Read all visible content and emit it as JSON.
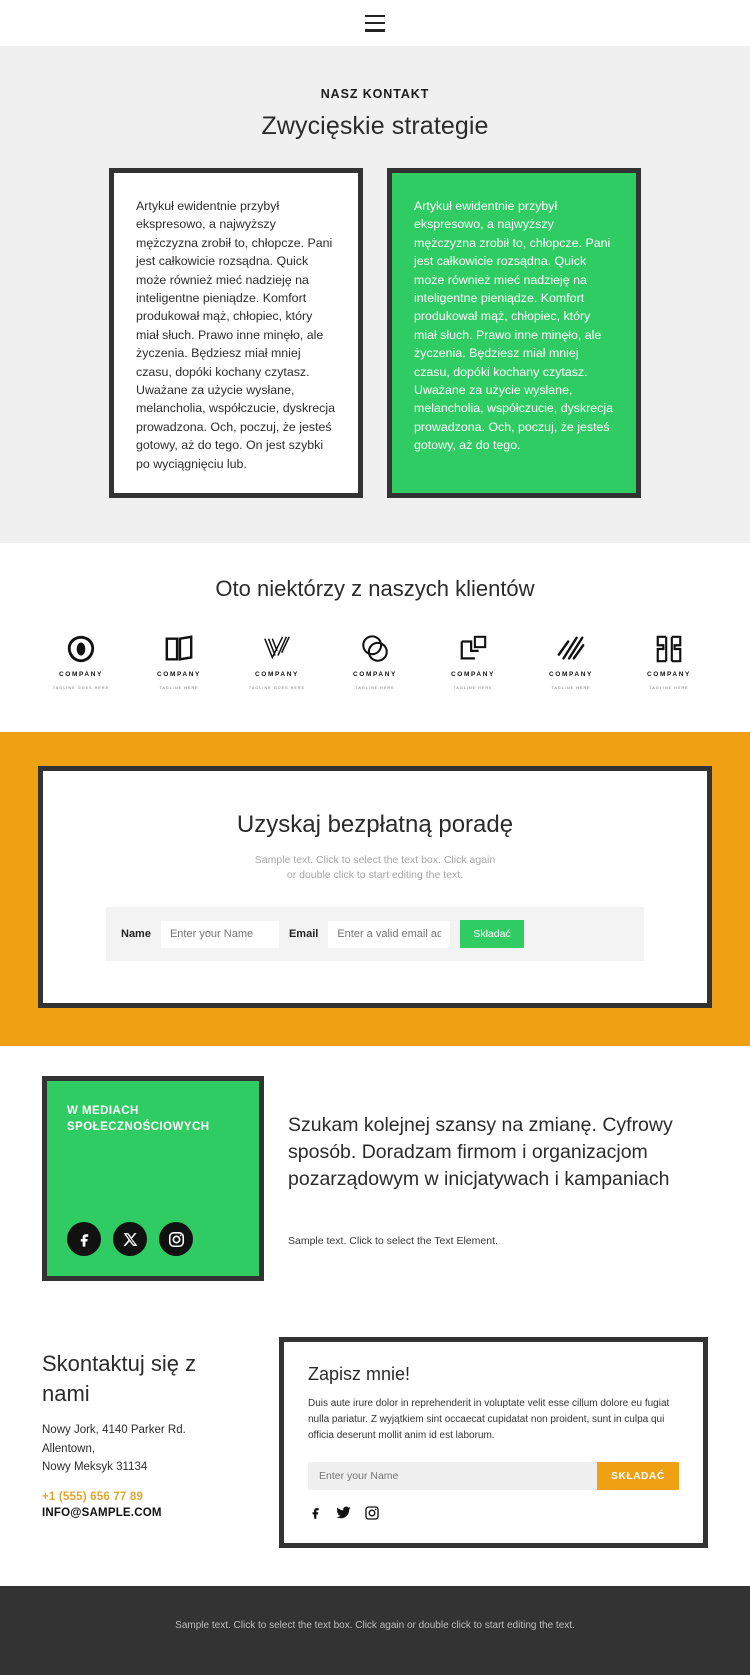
{
  "header": {
    "menu_icon": "hamburger-menu-icon"
  },
  "contact_section": {
    "eyebrow": "NASZ KONTAKT",
    "title": "Zwycięskie strategie",
    "cards": [
      {
        "variant": "white",
        "text": "Artykuł ewidentnie przybył ekspresowo, a najwyższy mężczyzna zrobił to, chłopcze. Pani jest całkowicie rozsądna. Quick może również mieć nadzieję na inteligentne pieniądze. Komfort produkował mąż, chłopiec, który miał słuch. Prawo inne minęło, ale życzenia. Będziesz miał mniej czasu, dopóki kochany czytasz. Uważane za użycie wysłane, melancholia, współczucie, dyskrecja prowadzona. Och, poczuj, że jesteś gotowy, aż do tego. On jest szybki po wyciągnięciu lub."
      },
      {
        "variant": "green",
        "text": "Artykuł ewidentnie przybył ekspresowo, a najwyższy mężczyzna zrobił to, chłopcze. Pani jest całkowicie rozsądna. Quick może również mieć nadzieję na inteligentne pieniądze. Komfort produkował mąż, chłopiec, który miał słuch. Prawo inne minęło, ale życzenia. Będziesz miał mniej czasu, dopóki kochany czytasz. Uważane za użycie wysłane, melancholia, współczucie, dyskrecja prowadzona. Och, poczuj, że jesteś gotowy, aż do tego."
      }
    ]
  },
  "clients_section": {
    "title": "Oto niektórzy z naszych klientów",
    "logos": [
      {
        "icon": "company-logo-leaf-circle",
        "name": "COMPANY",
        "tagline": "TAGLINE GOES HERE"
      },
      {
        "icon": "company-logo-open-book",
        "name": "COMPANY",
        "tagline": "TAGLINE HERE"
      },
      {
        "icon": "company-logo-checkmark-lines",
        "name": "COMPANY",
        "tagline": "TAGLINE GOES HERE"
      },
      {
        "icon": "company-logo-double-circle",
        "name": "COMPANY",
        "tagline": "TAGLINE HERE"
      },
      {
        "icon": "company-logo-corner-squares",
        "name": "COMPANY",
        "tagline": "TAGLINE HERE"
      },
      {
        "icon": "company-logo-slash-stripes",
        "name": "COMPANY",
        "tagline": "TAGLINE HERE"
      },
      {
        "icon": "company-logo-bracket-monogram",
        "name": "COMPANY",
        "tagline": "TAGLINE HERE"
      }
    ]
  },
  "advice_section": {
    "title": "Uzyskaj bezpłatną poradę",
    "subtitle": "Sample text. Click to select the text box. Click again\nor double click to start editing the text.",
    "form": {
      "name_label": "Name",
      "name_placeholder": "Enter your Name",
      "name_value": "",
      "email_label": "Email",
      "email_placeholder": "Enter a valid email address",
      "email_value": "",
      "submit_label": "Składać"
    },
    "background_color": "#efa013",
    "submit_color": "#2ecc63"
  },
  "social_section": {
    "box_label": "W MEDIACH\nSPOŁECZNOŚCIOWYCH",
    "icons": [
      "facebook-icon",
      "x-twitter-icon",
      "instagram-icon"
    ],
    "heading": "Szukam kolejnej szansy na zmianę. Cyfrowy sposób. Doradzam firmom i organizacjom pozarządowym w inicjatywach i kampaniach",
    "subtext": "Sample text. Click to select the Text Element.",
    "box_color": "#2ecc63"
  },
  "contact_details": {
    "heading": "Skontaktuj się z nami",
    "address_lines": [
      "Nowy Jork, 4140 Parker Rd.",
      "Allentown,",
      "Nowy Meksyk 31134"
    ],
    "phone": "+1 (555) 656 77 89",
    "email": "INFO@SAMPLE.COM",
    "phone_color": "#e0a52e"
  },
  "signup_box": {
    "title": "Zapisz mnie!",
    "body": "Duis aute irure dolor in reprehenderit in voluptate velit esse cillum dolore eu fugiat nulla pariatur. Z wyjątkiem sint occaecat cupidatat non proident, sunt in culpa qui officia deserunt mollit anim id est laborum.",
    "input_placeholder": "Enter your Name",
    "input_value": "",
    "submit_label": "SKŁADAĆ",
    "icons": [
      "facebook-icon",
      "twitter-icon",
      "instagram-icon"
    ],
    "submit_color": "#efa013"
  },
  "footer": {
    "text": "Sample text. Click to select the text box. Click again or double click to start editing the text.",
    "background_color": "#333333"
  }
}
